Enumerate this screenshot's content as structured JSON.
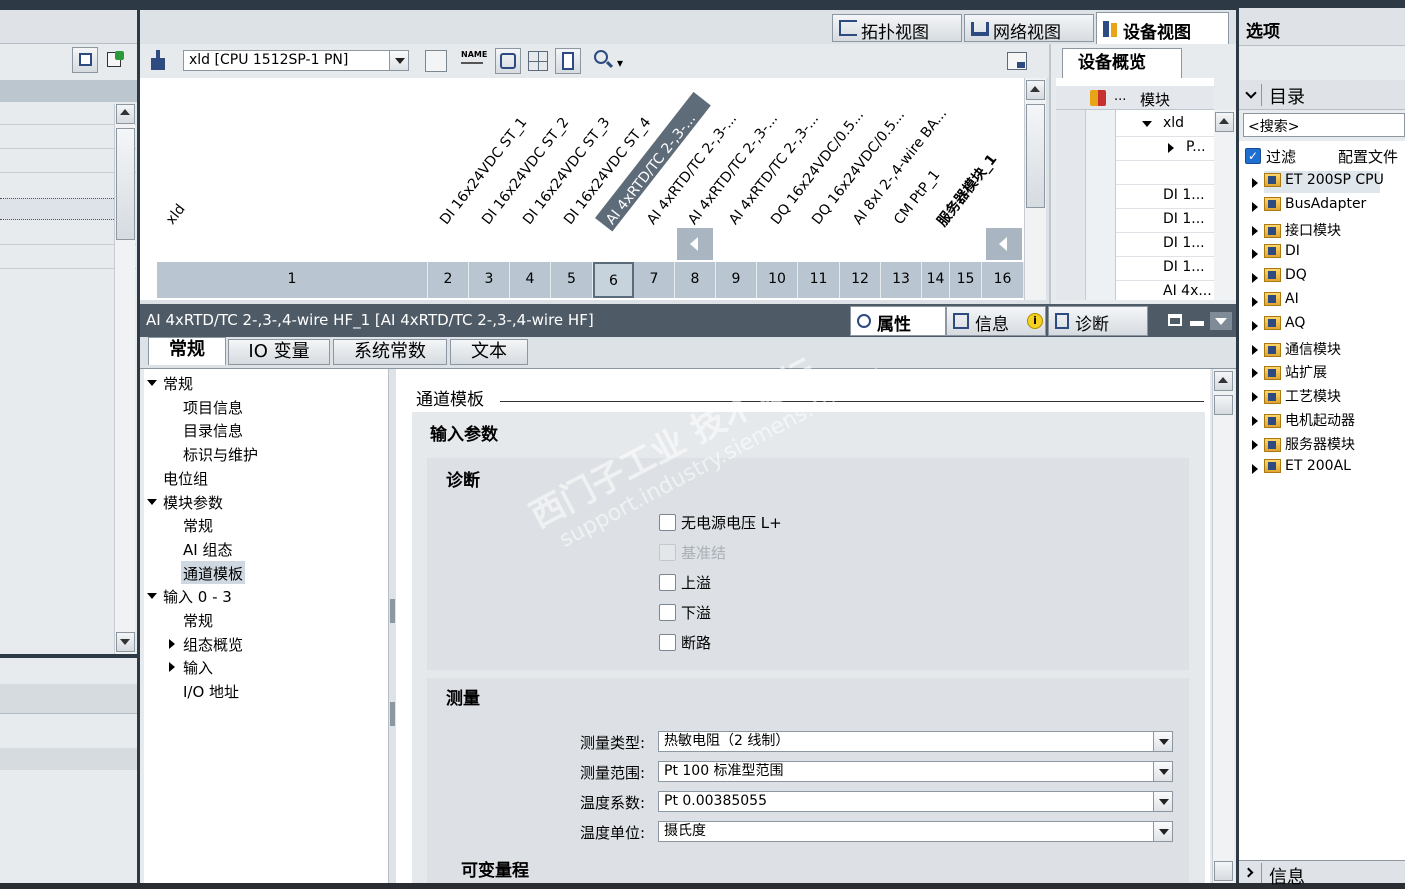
{
  "top_view_tabs": [
    "拓扑视图",
    "网络视图",
    "设备视图"
  ],
  "options_title": "选项",
  "device_toolbar": {
    "device_select": "xld [CPU 1512SP-1 PN]"
  },
  "device_overview": {
    "tab": "设备概览",
    "col_module": "模块",
    "rows": [
      "xld",
      "P...",
      "",
      "DI 1...",
      "DI 1...",
      "DI 1...",
      "DI 1...",
      "AI 4x..."
    ]
  },
  "rack": {
    "cpu_label": "xld",
    "module_labels": [
      "DI 16x24VDC ST_1",
      "DI 16x24VDC ST_2",
      "DI 16x24VDC ST_3",
      "DI 16x24VDC ST_4",
      "AI 4xRTD/TC 2-,3-...",
      "AI 4xRTD/TC 2-,3-...",
      "AI 4xRTD/TC 2-,3-...",
      "AI 4xRTD/TC 2-,3-...",
      "DQ 16x24VDC/0.5...",
      "DQ 16x24VDC/0.5...",
      "AI 8xI 2-,4-wire BA...",
      "CM PtP_1",
      "服务器模块_1"
    ],
    "slots": [
      "1",
      "2",
      "3",
      "4",
      "5",
      "6",
      "7",
      "8",
      "9",
      "10",
      "11",
      "12",
      "13",
      "14",
      "15",
      "16"
    ]
  },
  "inspector": {
    "title": "AI 4xRTD/TC 2-,3-,4-wire HF_1 [AI 4xRTD/TC 2-,3-,4-wire HF]",
    "right_tabs": [
      "属性",
      "信息",
      "诊断"
    ],
    "tabs": [
      "常规",
      "IO 变量",
      "系统常数",
      "文本"
    ],
    "nav": [
      {
        "label": "常规",
        "level": 0,
        "arrow": "down"
      },
      {
        "label": "项目信息",
        "level": 1,
        "arrow": ""
      },
      {
        "label": "目录信息",
        "level": 1,
        "arrow": ""
      },
      {
        "label": "标识与维护",
        "level": 1,
        "arrow": ""
      },
      {
        "label": "电位组",
        "level": 0,
        "arrow": ""
      },
      {
        "label": "模块参数",
        "level": 0,
        "arrow": "down"
      },
      {
        "label": "常规",
        "level": 1,
        "arrow": ""
      },
      {
        "label": "AI 组态",
        "level": 1,
        "arrow": ""
      },
      {
        "label": "通道模板",
        "level": 1,
        "arrow": ""
      },
      {
        "label": "输入 0 - 3",
        "level": 0,
        "arrow": "down"
      },
      {
        "label": "常规",
        "level": 1,
        "arrow": ""
      },
      {
        "label": "组态概览",
        "level": 1,
        "arrow": "right"
      },
      {
        "label": "输入",
        "level": 1,
        "arrow": "right"
      },
      {
        "label": "I/O 地址",
        "level": 1,
        "arrow": ""
      }
    ],
    "section_title": "通道模板",
    "input_params": "输入参数",
    "diag_title": "诊断",
    "checks": [
      {
        "label": "无电源电压 L+",
        "disabled": false
      },
      {
        "label": "基准结",
        "disabled": true
      },
      {
        "label": "上溢",
        "disabled": false
      },
      {
        "label": "下溢",
        "disabled": false
      },
      {
        "label": "断路",
        "disabled": false
      }
    ],
    "measure_title": "测量",
    "fields": [
      {
        "label": "测量类型:",
        "value": "热敏电阻（2 线制）"
      },
      {
        "label": "测量范围:",
        "value": "Pt 100 标准型范围"
      },
      {
        "label": "温度系数:",
        "value": "Pt 0.00385055"
      },
      {
        "label": "温度单位:",
        "value": "摄氏度"
      }
    ],
    "variable_range": "可变量程"
  },
  "catalog": {
    "title": "目录",
    "search_placeholder": "<搜索>",
    "filter_label": "过滤",
    "profile_label": "配置文件",
    "items": [
      "ET 200SP CPU",
      "BusAdapter",
      "接口模块",
      "DI",
      "DQ",
      "AI",
      "AQ",
      "通信模块",
      "站扩展",
      "工艺模块",
      "电机起动器",
      "服务器模块",
      "ET 200AL"
    ],
    "info_title": "信息"
  },
  "watermark": {
    "line1": "西门子工业 技术论坛",
    "line2": "support.industry.siemens.com/cs"
  }
}
